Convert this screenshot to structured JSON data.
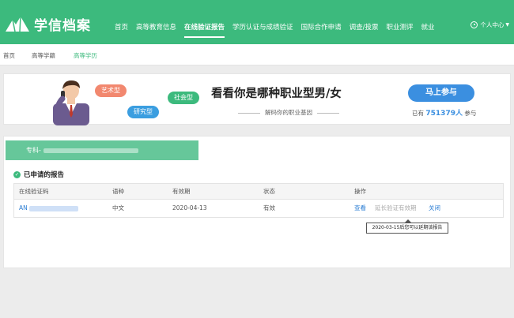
{
  "header": {
    "logo_text": "学信档案",
    "nav": [
      "首页",
      "高等教育信息",
      "在线验证报告",
      "学历认证与成绩验证",
      "国际合作申请",
      "调查/投票",
      "职业测评",
      "就业"
    ],
    "active_nav_index": 2,
    "user_menu": "个人中心"
  },
  "breadcrumb": [
    "首页",
    "高等学籍",
    "高等学历"
  ],
  "banner": {
    "tags": [
      "艺术型",
      "社会型",
      "研究型"
    ],
    "title": "看看你是哪种职业型男/女",
    "subtitle": "解码你的职业基因",
    "join_button": "马上参与",
    "count_prefix": "已有",
    "count": "751379人",
    "count_suffix": "参与"
  },
  "degree_tab": {
    "label": "专科-"
  },
  "reports": {
    "title": "已申请的报告",
    "columns": [
      "在线验证码",
      "语种",
      "有效期",
      "状态",
      "操作"
    ],
    "rows": [
      {
        "code": "AN",
        "language": "中文",
        "expiry": "2020-04-13",
        "status": "有效",
        "actions": [
          "查看",
          "延长验证有效期",
          "关闭"
        ]
      }
    ],
    "tooltip": "2020-03-15后您可以延期该报告"
  },
  "colors": {
    "brand_green": "#3cba7d",
    "link_blue": "#2e7fd4",
    "button_blue": "#3b8fe0"
  }
}
